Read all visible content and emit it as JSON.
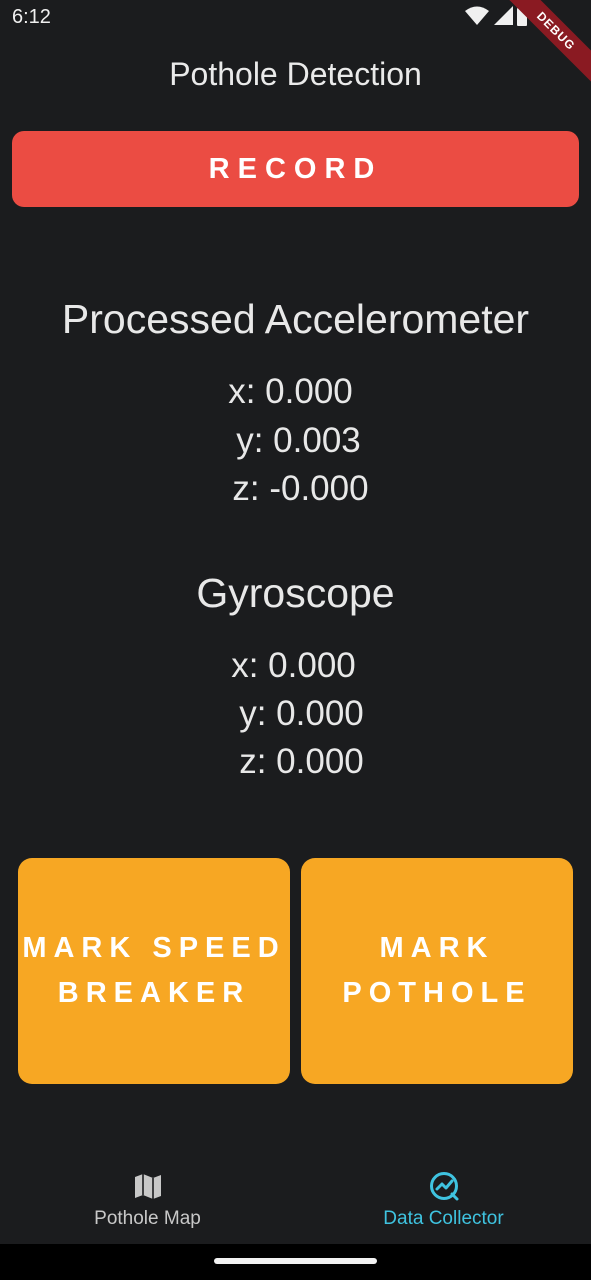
{
  "status_bar": {
    "time": "6:12",
    "debug_label": "DEBUG",
    "icons": [
      "wifi-icon",
      "signal-icon",
      "battery-icon"
    ]
  },
  "app_bar": {
    "title": "Pothole Detection"
  },
  "record_button": {
    "label": "RECORD",
    "color": "#eb4c43"
  },
  "accelerometer": {
    "title": "Processed Accelerometer",
    "x": "x: 0.000",
    "y": "y: 0.003",
    "z": "z: -0.000"
  },
  "gyroscope": {
    "title": "Gyroscope",
    "x": "x: 0.000",
    "y": "y: 0.000",
    "z": "z: 0.000"
  },
  "mark_buttons": {
    "speed_breaker": {
      "line1": "MARK SPEED",
      "line2": "BREAKER"
    },
    "pothole": {
      "line1": "MARK",
      "line2": "POTHOLE"
    },
    "color": "#f7a723"
  },
  "bottom_nav": {
    "items": [
      {
        "label": "Pothole Map",
        "icon": "map-icon",
        "active": false
      },
      {
        "label": "Data Collector",
        "icon": "chart-icon",
        "active": true
      }
    ],
    "active_color": "#3fc3e0",
    "inactive_color": "#c8c8c8"
  }
}
